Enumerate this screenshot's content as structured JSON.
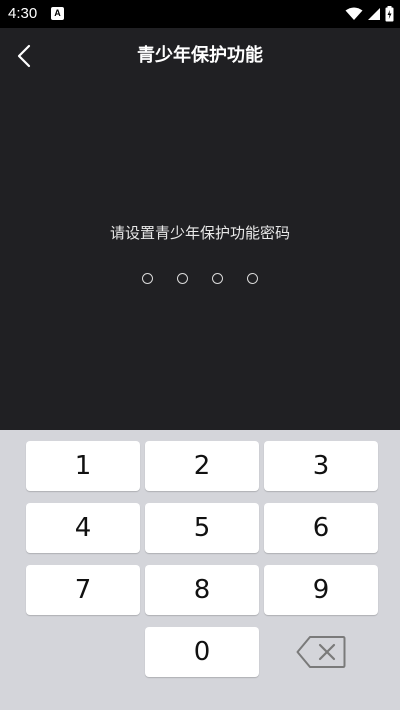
{
  "status_bar": {
    "time": "4:30",
    "notification_icon_letter": "A",
    "icons": [
      "wifi-icon",
      "cell-signal-icon",
      "battery-icon"
    ]
  },
  "header": {
    "back_icon": "chevron-left-icon",
    "title": "青少年保护功能"
  },
  "main": {
    "prompt": "请设置青少年保护功能密码",
    "pin_length": 4,
    "pin_entered": 0
  },
  "keypad": {
    "keys": [
      "1",
      "2",
      "3",
      "4",
      "5",
      "6",
      "7",
      "8",
      "9",
      "0"
    ],
    "delete_icon": "backspace-icon"
  },
  "colors": {
    "background": "#202023",
    "keypad_background": "#d4d5da",
    "key": "#ffffff",
    "text": "#ffffff"
  }
}
